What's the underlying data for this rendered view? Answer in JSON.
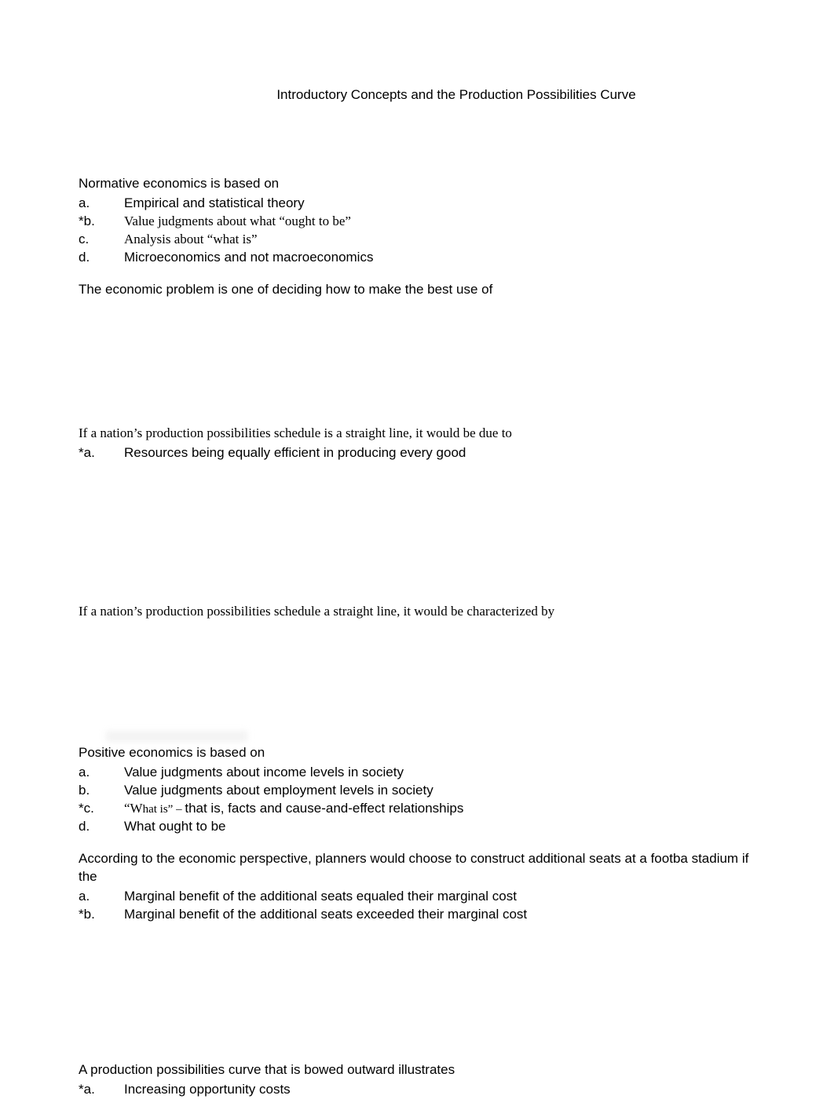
{
  "title": "Introductory Concepts and the Production Possibilities Curve",
  "q1": {
    "stem": "Normative economics is based on",
    "a_label": "a.",
    "a_text": "Empirical and statistical theory",
    "b_label": "*b.",
    "b_text": "Value judgments about what “ought to be”",
    "c_label": "c.",
    "c_text": "Analysis about “what is”",
    "d_label": "d.",
    "d_text": "Microeconomics and not macroeconomics"
  },
  "q2": {
    "stem": "The economic problem is one of deciding how to make the best use of"
  },
  "q3": {
    "stem": "If a nation’s production possibilities schedule is a straight line, it would be due to",
    "a_label": "*a.",
    "a_text": "Resources being equally efficient in producing every good"
  },
  "q4": {
    "stem": "If a nation’s production possibilities schedule a straight line, it would be characterized by"
  },
  "q5": {
    "stem": "Positive economics is based on",
    "a_label": "a.",
    "a_text": "Value judgments about income levels in society",
    "b_label": "b.",
    "b_text": "Value judgments about employment levels in society",
    "c_label": "*c.",
    "c_prefix": "“W",
    "c_mid": "hat is” – ",
    "c_suffix": "that is, facts and cause-and-effect relationships",
    "d_label": "d.",
    "d_text": "What ought to be"
  },
  "q6": {
    "stem": "According to the economic perspective, planners would choose to construct additional seats at a footba stadium if the",
    "a_label": "a.",
    "a_text": "Marginal benefit of the additional seats equaled their marginal cost",
    "b_label": "*b.",
    "b_text": "Marginal benefit of the additional seats exceeded their marginal cost"
  },
  "q7": {
    "stem": "A production possibilities curve that is bowed outward illustrates",
    "a_label": "*a.",
    "a_text": "Increasing opportunity costs"
  }
}
